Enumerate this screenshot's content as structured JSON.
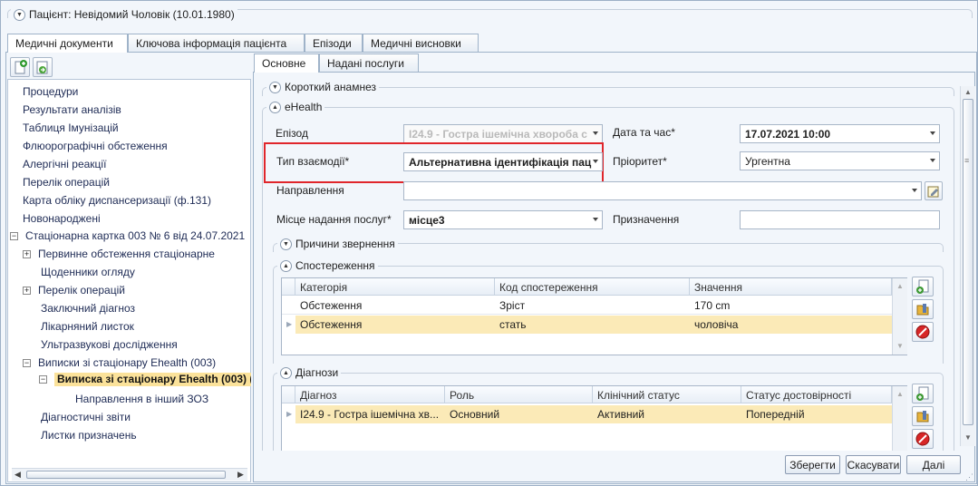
{
  "window": {
    "title": "Пацієнт: Невідомий Чоловік (10.01.1980)"
  },
  "main_tabs": [
    "Медичні документи",
    "Ключова інформація пацієнта",
    "Епізоди",
    "Медичні висновки"
  ],
  "tree": {
    "items": [
      "Процедури",
      "Результати  аналізів",
      "Таблиця Імунізацій",
      "Флюорографічні обстеження",
      "Алергічні реакції",
      "Перелік операцій",
      "Карта обліку диспансеризації (ф.131)",
      "Новонароджені",
      "Стаціонарна картка 003 № 6 від 24.07.2021"
    ],
    "sub_items": [
      "Первинне обстеження стаціонарне",
      "Щоденники огляду",
      "Перелік операцій",
      "Заключний діагноз",
      "Лікарняний листок",
      "Ультразвукові дослідження",
      "Виписки зі стаціонару Ehealth (003)"
    ],
    "selected": "Виписка зі стаціонару Ehealth (003) (",
    "child": "Направлення в інший ЗОЗ",
    "tail": [
      "Діагностичні звіти",
      "Листки призначень"
    ]
  },
  "sub_tabs": [
    "Основне",
    "Надані послуги"
  ],
  "sections": {
    "anamnesis": "Короткий анамнез",
    "ehealth": "eHealth",
    "reasons": "Причини звернення",
    "observations": "Спостереження",
    "diagnoses": "Діагнози"
  },
  "form": {
    "episode_label": "Епізод",
    "episode_value": "I24.9 - Гостра ішемічна хвороба с",
    "datetime_label": "Дата та час*",
    "datetime_value": "17.07.2021 10:00",
    "interaction_label": "Тип взаємодії*",
    "interaction_value": "Альтернативна ідентифікація пац",
    "priority_label": "Пріоритет*",
    "priority_value": "Ургентна",
    "referral_label": "Направлення",
    "referral_value": "",
    "place_label": "Місце надання послуг*",
    "place_value": "місце3",
    "assignment_label": "Призначення",
    "assignment_value": ""
  },
  "observations": {
    "columns": [
      "Категорія",
      "Код спостереження",
      "Значення"
    ],
    "rows": [
      [
        "Обстеження",
        "Зріст",
        "170 cm"
      ],
      [
        "Обстеження",
        "стать",
        "чоловіча"
      ]
    ]
  },
  "diagnoses": {
    "columns": [
      "Діагноз",
      "Роль",
      "Клінічний статус",
      "Статус достовірності"
    ],
    "rows": [
      [
        "I24.9 - Гостра ішемічна хв...",
        "Основний",
        "Активний",
        "Попередній"
      ]
    ]
  },
  "buttons": {
    "save": "Зберегти",
    "cancel": "Скасувати",
    "next": "Далі"
  },
  "colors": {
    "highlight_box": "#e0262b",
    "selected_row": "#fbeab7"
  }
}
